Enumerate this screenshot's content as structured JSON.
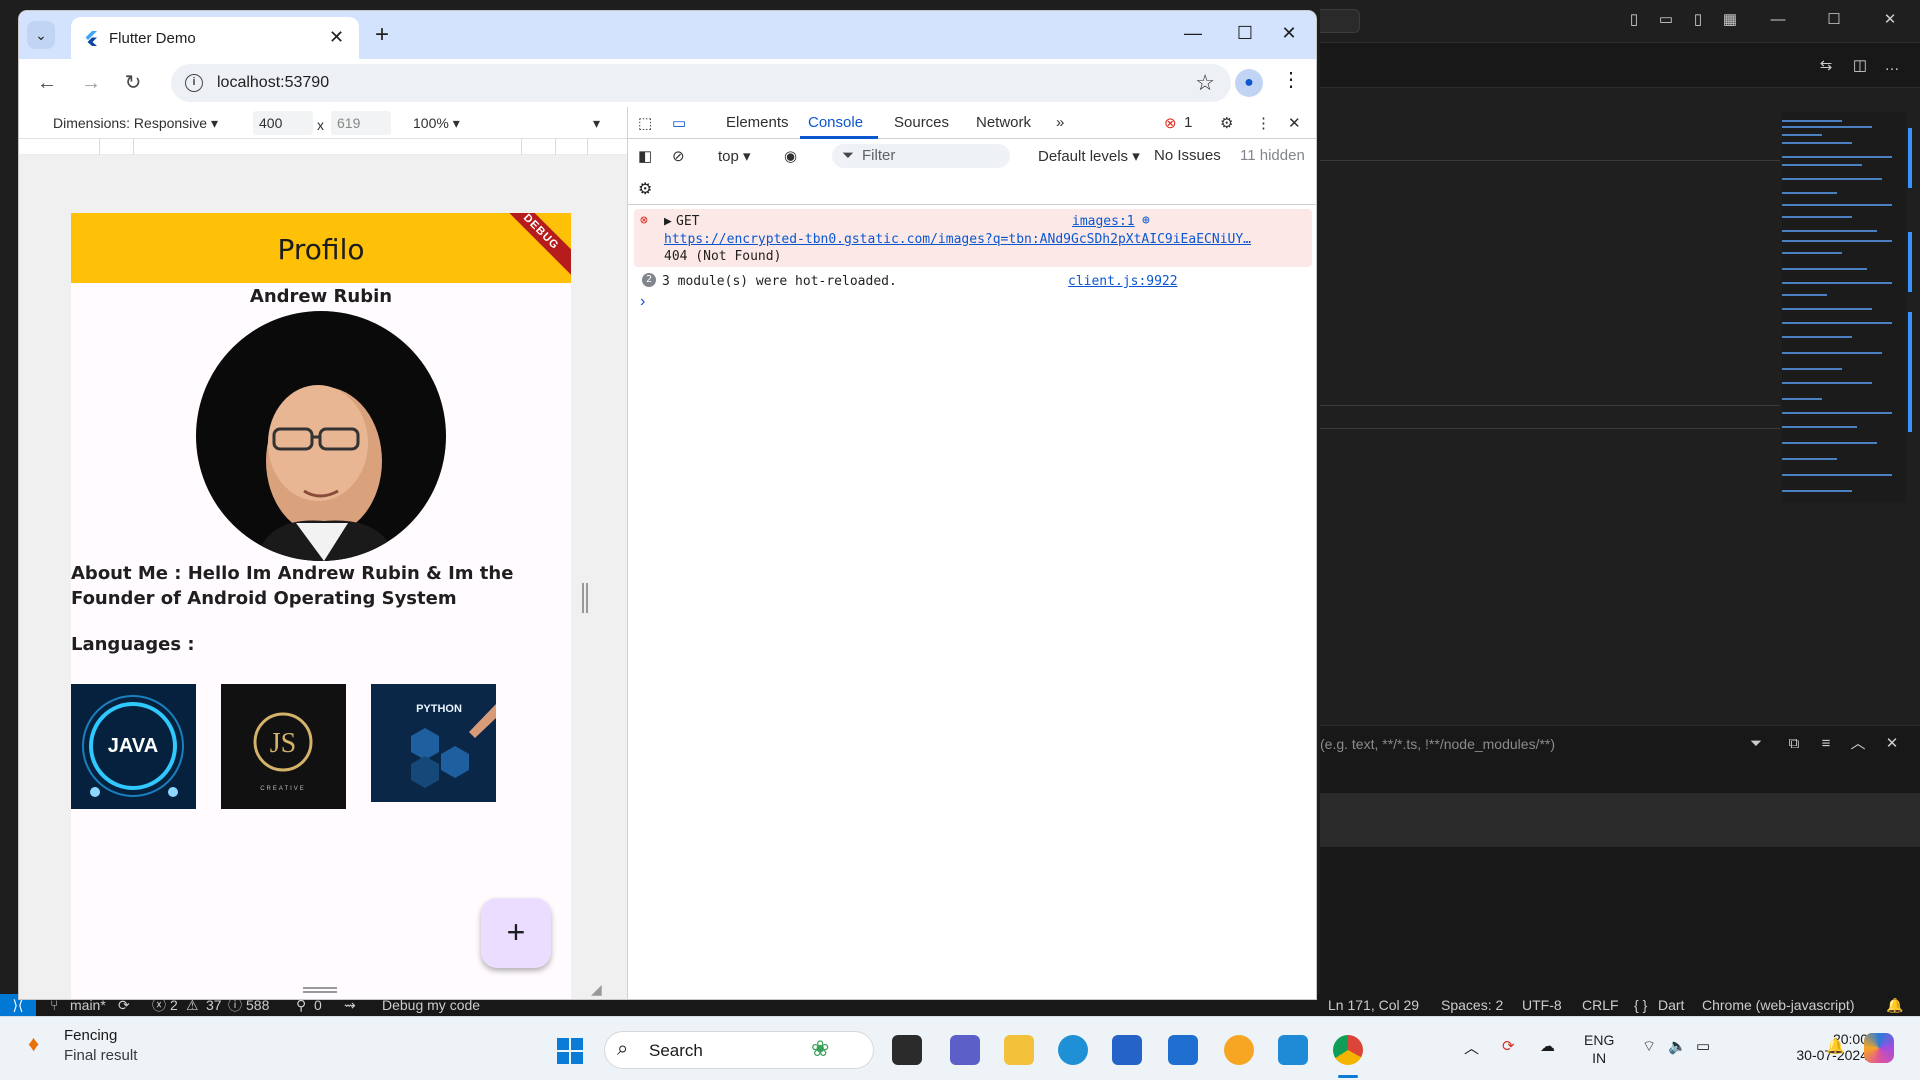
{
  "browser": {
    "tab_title": "Flutter Demo",
    "url": "localhost:53790"
  },
  "device_toolbar": {
    "dimensions_label": "Dimensions: Responsive",
    "width": "400",
    "x_sep": "x",
    "height": "619",
    "zoom": "100%"
  },
  "app": {
    "title": "Profilo",
    "debug_banner": "DEBUG",
    "name": "Andrew Rubin",
    "about": "About Me : Hello Im Andrew Rubin & Im the Founder of Android Operating System",
    "languages_label": "Languages :",
    "lang_images": [
      {
        "label": "JAVA"
      },
      {
        "label": "JS",
        "sub": "CREATIVE"
      },
      {
        "label": "PYTHON"
      }
    ],
    "fab_label": "+"
  },
  "devtools": {
    "tabs": [
      "Elements",
      "Console",
      "Sources",
      "Network"
    ],
    "active_tab": "Console",
    "error_count": "1",
    "context": "top",
    "filter_placeholder": "Filter",
    "levels": "Default levels",
    "issues": "No Issues",
    "hidden": "11 hidden",
    "console": {
      "error_method": "GET",
      "error_source": "images:1",
      "error_url": "https://encrypted-tbn0.gstatic.com/images?q=tbn:ANd9GcSDh2pXtAIC9iEaECNiUY…",
      "error_status": "404 (Not Found)",
      "info_count": "2",
      "info_text": "3 module(s) were hot-reloaded.",
      "info_source": "client.js:9922"
    }
  },
  "vscode": {
    "search_hint": "(e.g. text, **/*.ts, !**/node_modules/**)",
    "status": {
      "branch": "main*",
      "errors": "2",
      "warnings": "37",
      "infos": "588",
      "ports": "0",
      "debug": "Debug my code",
      "position": "Ln 171, Col 29",
      "spaces": "Spaces: 2",
      "encoding": "UTF-8",
      "eol": "CRLF",
      "language": "Dart",
      "device": "Chrome (web-javascript)"
    }
  },
  "taskbar": {
    "weather_title": "Fencing",
    "weather_sub": "Final result",
    "search": "Search",
    "lang_top": "ENG",
    "lang_bottom": "IN",
    "time": "20:00",
    "date": "30-07-2024"
  },
  "colors": {
    "appbar": "#fec107",
    "fab": "#eaddff",
    "devtools_accent": "#0b57d0",
    "error_bg": "#fce8e6",
    "vscode_remote": "#0078d4"
  }
}
